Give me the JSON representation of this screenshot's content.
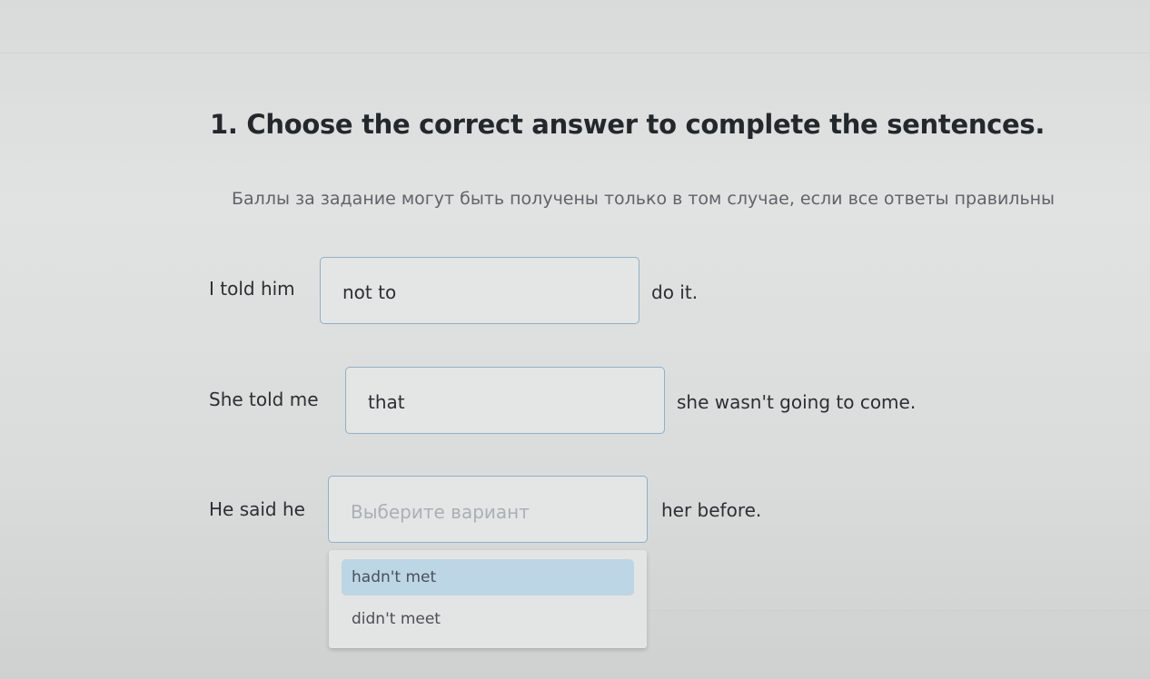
{
  "task": {
    "title": "1. Choose the correct answer to complete the sentences.",
    "hint": "Баллы за задание могут быть получены только в том случае, если все ответы правильны"
  },
  "sentences": [
    {
      "before": "I told him",
      "selected": "not to",
      "after": "do it."
    },
    {
      "before": "She told me",
      "selected": "that",
      "after": "she wasn't going to come."
    },
    {
      "before": "He said he",
      "placeholder": "Выберите вариант",
      "after": "her before."
    }
  ],
  "dropdown": {
    "options": [
      "hadn't met",
      "didn't meet"
    ],
    "highlighted_index": 0
  },
  "colors": {
    "select_border": "#8fb0c9",
    "option_highlight": "#bcd6e6",
    "placeholder_text": "#a9b0b6"
  }
}
